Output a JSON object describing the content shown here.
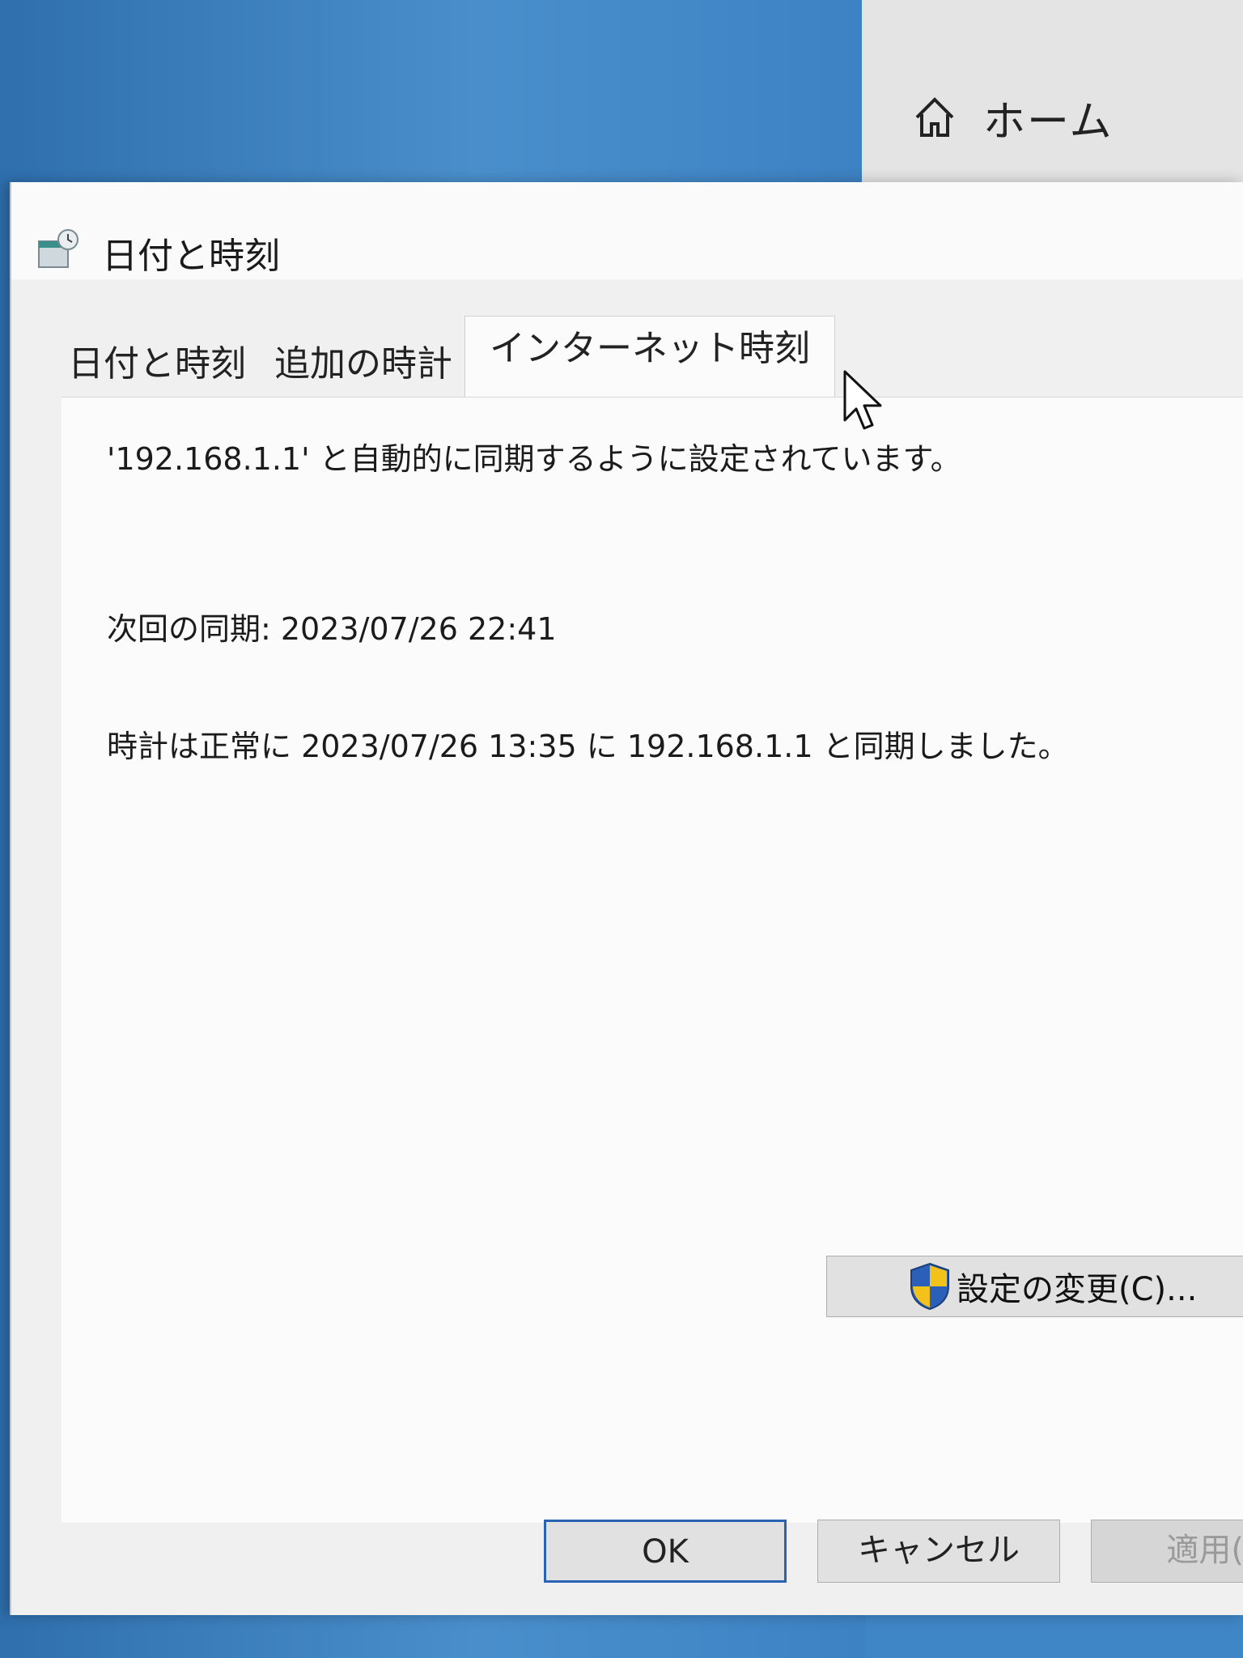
{
  "background": {
    "home_label": "ホーム"
  },
  "dialog": {
    "title": "日付と時刻",
    "tabs": [
      {
        "label": "日付と時刻"
      },
      {
        "label": "追加の時計"
      },
      {
        "label": "インターネット時刻",
        "active": true
      }
    ],
    "messages": {
      "sync_setting": "'192.168.1.1' と自動的に同期するように設定されています。",
      "next_sync": "次回の同期: 2023/07/26 22:41",
      "last_sync": "時計は正常に 2023/07/26 13:35 に 192.168.1.1 と同期しました。"
    },
    "change_settings_button": "設定の変更(C)...",
    "footer": {
      "ok": "OK",
      "cancel": "キャンセル",
      "apply": "適用("
    }
  },
  "colors": {
    "desktop_blue": "#3f86c6",
    "ok_border": "#2a62b5",
    "shield_blue": "#2b5fb8",
    "shield_yellow": "#f2c21b"
  }
}
